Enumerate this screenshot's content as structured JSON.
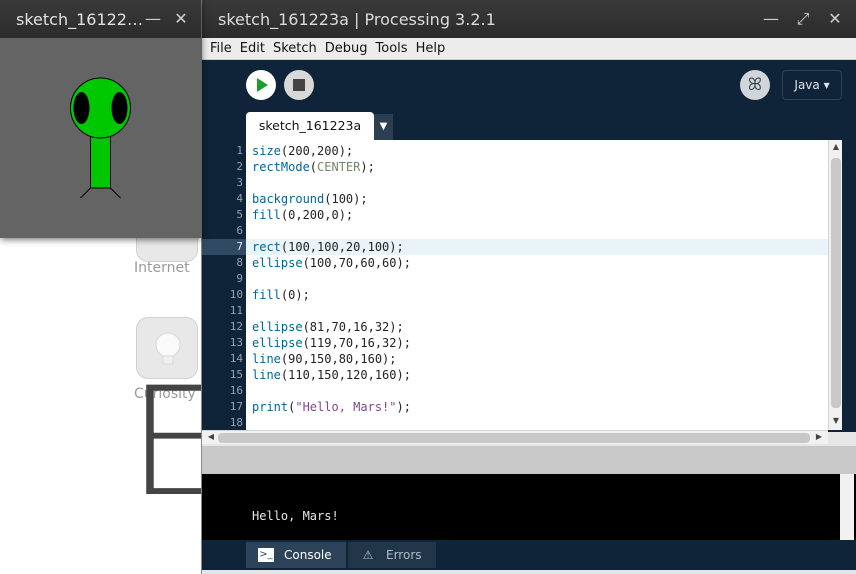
{
  "desktop": {
    "items": [
      {
        "label": "Internet"
      },
      {
        "label": "Curiosity"
      }
    ],
    "big_letter": "E"
  },
  "sketch_window": {
    "title": "sketch_16122…",
    "controls": {
      "minimize": "—",
      "close": "✕"
    }
  },
  "ide_window": {
    "title": "sketch_161223a | Processing 3.2.1",
    "controls": {
      "minimize": "—",
      "maximize": "⤢",
      "close": "✕"
    },
    "menu": [
      "File",
      "Edit",
      "Sketch",
      "Debug",
      "Tools",
      "Help"
    ],
    "toolbar": {
      "run_icon": "play-icon",
      "stop_icon": "stop-icon",
      "debug_icon": "butterfly-icon",
      "mode_label": "Java ▾"
    },
    "tab": {
      "label": "sketch_161223a",
      "arrow": "▼"
    },
    "code": [
      {
        "n": "1",
        "text": "size(200,200);"
      },
      {
        "n": "2",
        "text": "rectMode(CENTER);"
      },
      {
        "n": "3",
        "text": ""
      },
      {
        "n": "4",
        "text": "background(100);"
      },
      {
        "n": "5",
        "text": "fill(0,200,0);"
      },
      {
        "n": "6",
        "text": ""
      },
      {
        "n": "7",
        "text": "rect(100,100,20,100);"
      },
      {
        "n": "8",
        "text": "ellipse(100,70,60,60);"
      },
      {
        "n": "9",
        "text": ""
      },
      {
        "n": "10",
        "text": "fill(0);"
      },
      {
        "n": "11",
        "text": ""
      },
      {
        "n": "12",
        "text": "ellipse(81,70,16,32);"
      },
      {
        "n": "13",
        "text": "ellipse(119,70,16,32);"
      },
      {
        "n": "14",
        "text": "line(90,150,80,160);"
      },
      {
        "n": "15",
        "text": "line(110,150,120,160);"
      },
      {
        "n": "16",
        "text": ""
      },
      {
        "n": "17",
        "text": "print(\"Hello, Mars!\");"
      },
      {
        "n": "18",
        "text": ""
      }
    ],
    "highlighted_line": "7",
    "console_output": "Hello, Mars!",
    "bottom_tabs": [
      {
        "label": "Console",
        "icon": "terminal-icon"
      },
      {
        "label": "Errors",
        "icon": "warning-icon"
      }
    ]
  },
  "colors": {
    "editor_dark": "#0f2438",
    "alien_green": "#00c800",
    "sketch_bg": "#646464"
  }
}
